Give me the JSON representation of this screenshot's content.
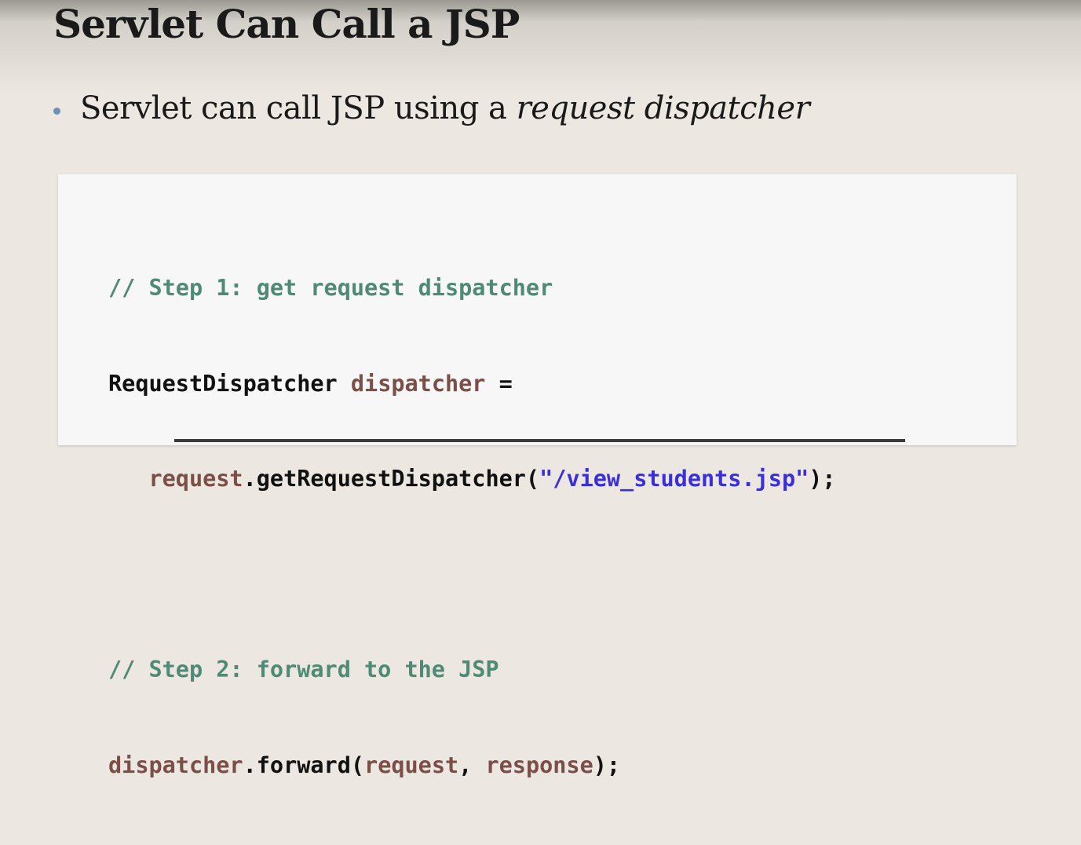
{
  "slide": {
    "title": "Servlet Can Call a JSP",
    "bullet": {
      "text_prefix": "Servlet can call JSP using a ",
      "text_emphasis": "request dispatcher"
    }
  },
  "code": {
    "line1": {
      "comment": "// Step 1: get request dispatcher"
    },
    "line2": {
      "type": "RequestDispatcher",
      "var": "dispatcher",
      "op": " ="
    },
    "line3": {
      "indent": "   ",
      "obj": "request",
      "method": ".getRequestDispatcher(",
      "string": "\"/view_students.jsp\"",
      "end": ");"
    },
    "line5": {
      "comment": "// Step 2: forward to the JSP"
    },
    "line6": {
      "obj": "dispatcher",
      "method": ".forward(",
      "arg1": "request",
      "sep": ", ",
      "arg2": "response",
      "end": ");"
    }
  },
  "colors": {
    "comment": "#4f8a76",
    "variable": "#7b4f48",
    "string": "#3a2fd8",
    "bullet": "#6f8fb5"
  }
}
